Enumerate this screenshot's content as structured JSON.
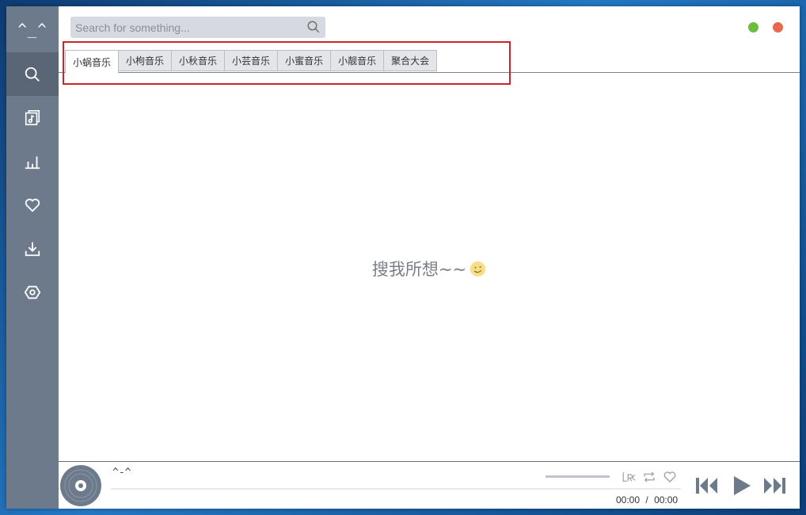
{
  "app": {
    "logo": "^_^"
  },
  "sidebar": {
    "items": [
      {
        "name": "search",
        "icon": "search-icon",
        "active": true
      },
      {
        "name": "playlist",
        "icon": "music-list-icon",
        "active": false
      },
      {
        "name": "charts",
        "icon": "bar-chart-icon",
        "active": false
      },
      {
        "name": "favorites",
        "icon": "heart-icon",
        "active": false
      },
      {
        "name": "downloads",
        "icon": "download-icon",
        "active": false
      },
      {
        "name": "settings",
        "icon": "hexagon-settings-icon",
        "active": false
      }
    ]
  },
  "search": {
    "placeholder": "Search for something...",
    "value": ""
  },
  "tabs": [
    {
      "label": "小蜗音乐",
      "active": true
    },
    {
      "label": "小枸音乐",
      "active": false
    },
    {
      "label": "小秋音乐",
      "active": false
    },
    {
      "label": "小芸音乐",
      "active": false
    },
    {
      "label": "小蜜音乐",
      "active": false
    },
    {
      "label": "小靓音乐",
      "active": false
    },
    {
      "label": "聚合大会",
      "active": false
    }
  ],
  "empty_state": {
    "text": "搜我所想~~",
    "icon": "smile-icon"
  },
  "player": {
    "title": "^-^",
    "current_time": "00:00",
    "separator": "/",
    "total_time": "00:00",
    "progress": 0
  },
  "colors": {
    "sidebar": "#6c7a8c",
    "sidebar_active": "#5a6676",
    "close_button": "#e8694d",
    "minimize_button": "#6cbf3e",
    "annotation": "#c9252b"
  }
}
